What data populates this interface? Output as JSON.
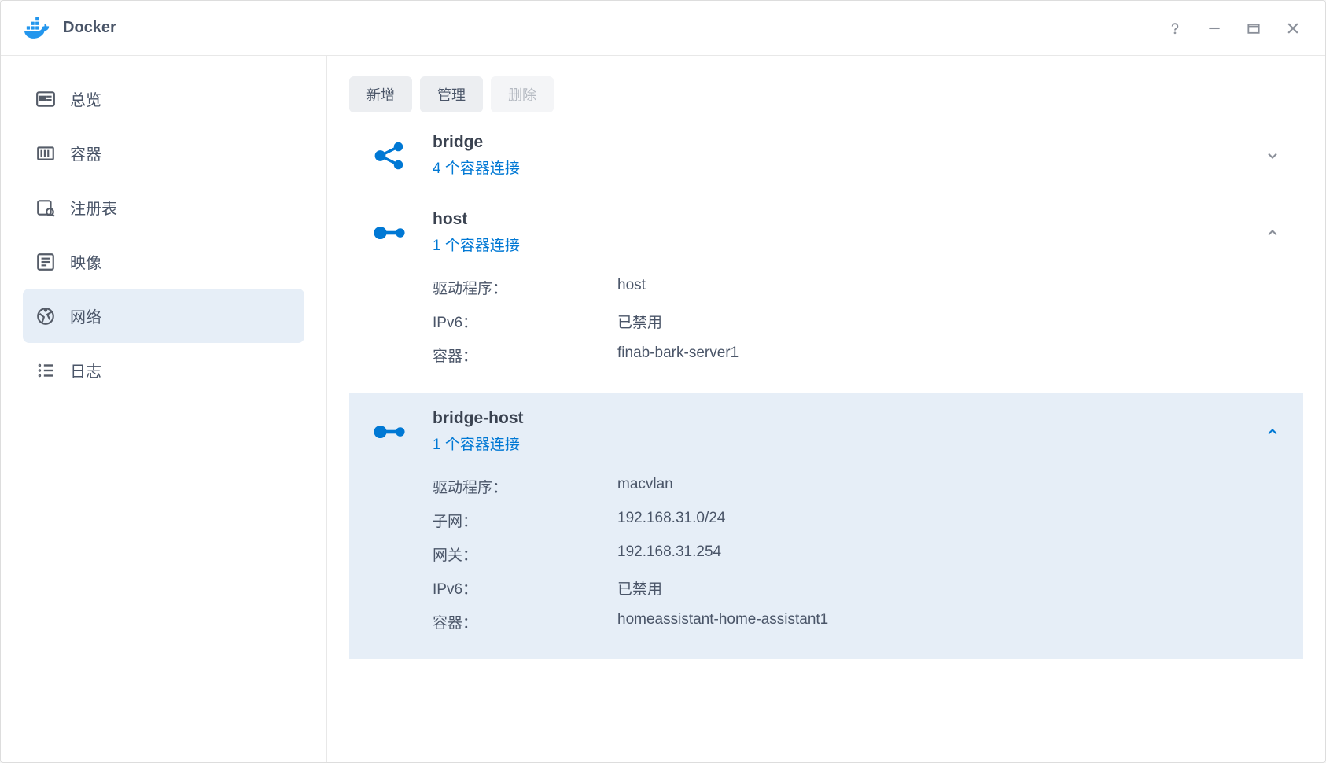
{
  "app": {
    "title": "Docker"
  },
  "sidebar": {
    "items": [
      {
        "label": "总览"
      },
      {
        "label": "容器"
      },
      {
        "label": "注册表"
      },
      {
        "label": "映像"
      },
      {
        "label": "网络"
      },
      {
        "label": "日志"
      }
    ]
  },
  "toolbar": {
    "add": "新增",
    "manage": "管理",
    "delete": "删除"
  },
  "labels": {
    "driver": "驱动程序：",
    "ipv6": "IPv6：",
    "container": "容器：",
    "subnet": "子网：",
    "gateway": "网关："
  },
  "networks": [
    {
      "name": "bridge",
      "sub": "4 个容器连接",
      "expanded": false,
      "icon": "share"
    },
    {
      "name": "host",
      "sub": "1 个容器连接",
      "expanded": true,
      "icon": "dumbbell",
      "details": {
        "driver": "host",
        "ipv6": "已禁用",
        "container": "finab-bark-server1"
      }
    },
    {
      "name": "bridge-host",
      "sub": "1 个容器连接",
      "expanded": true,
      "selected": true,
      "icon": "dumbbell",
      "details": {
        "driver": "macvlan",
        "subnet": "192.168.31.0/24",
        "gateway": "192.168.31.254",
        "ipv6": "已禁用",
        "container": "homeassistant-home-assistant1"
      }
    }
  ]
}
